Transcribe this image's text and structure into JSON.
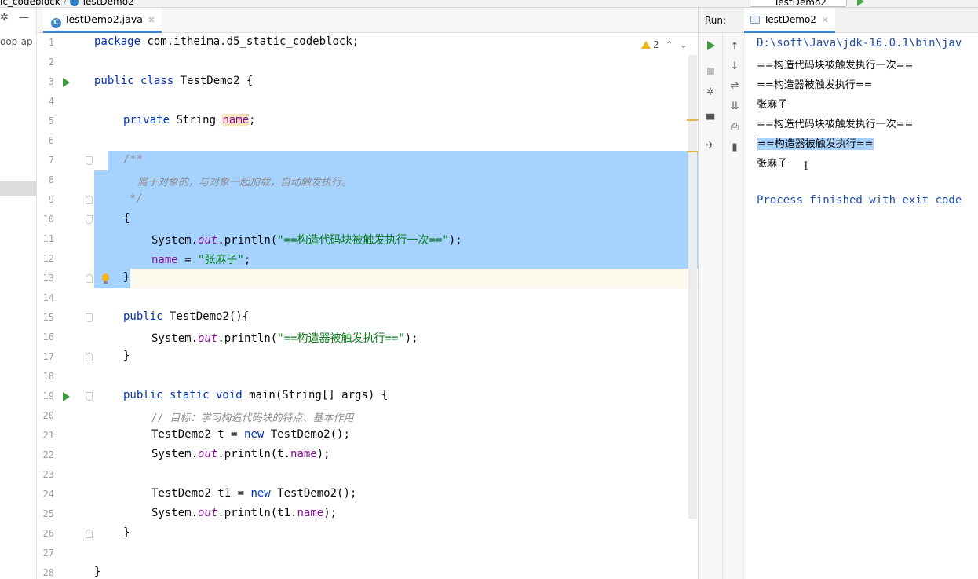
{
  "breadcrumb": {
    "items": [
      "ic_codeblock",
      "TestDemo2"
    ]
  },
  "run_config": {
    "name": "TestDemo2"
  },
  "project": {
    "partial_text": "oop-ap"
  },
  "editor": {
    "tab": {
      "label": "TestDemo2.java",
      "icon": "java-class-icon"
    },
    "warnings": {
      "count": "2"
    },
    "lines": [
      {
        "n": "1"
      },
      {
        "n": "2"
      },
      {
        "n": "3"
      },
      {
        "n": "4"
      },
      {
        "n": "5"
      },
      {
        "n": "6"
      },
      {
        "n": "7"
      },
      {
        "n": "8"
      },
      {
        "n": "9"
      },
      {
        "n": "10"
      },
      {
        "n": "11"
      },
      {
        "n": "12"
      },
      {
        "n": "13"
      },
      {
        "n": "14"
      },
      {
        "n": "15"
      },
      {
        "n": "16"
      },
      {
        "n": "17"
      },
      {
        "n": "18"
      },
      {
        "n": "19"
      },
      {
        "n": "20"
      },
      {
        "n": "21"
      },
      {
        "n": "22"
      },
      {
        "n": "23"
      },
      {
        "n": "24"
      },
      {
        "n": "25"
      },
      {
        "n": "26"
      },
      {
        "n": "27"
      },
      {
        "n": "28"
      }
    ],
    "code": {
      "l1_kw": "package",
      "l1_rest": " com.itheima.d5_static_codeblock;",
      "l3_kw": "public class",
      "l3_rest": " TestDemo2 {",
      "l5_kw": "private",
      "l5_type": " String ",
      "l5_field": "name",
      "l5_end": ";",
      "l7": "/**",
      "l8": "属于对象的，与对象一起加载，自动触发执行。",
      "l9": "*/",
      "l10": "{",
      "l11_a": "System.",
      "l11_out": "out",
      "l11_b": ".println(",
      "l11_str": "\"==构造代码块被触发执行一次==\"",
      "l11_c": ");",
      "l12_field": "name",
      "l12_eq": " = ",
      "l12_str": "\"张麻子\"",
      "l12_end": ";",
      "l13": "}",
      "l15_kw": "public",
      "l15_rest": " TestDemo2(){",
      "l16_a": "System.",
      "l16_out": "out",
      "l16_b": ".println(",
      "l16_str": "\"==构造器被触发执行==\"",
      "l16_c": ");",
      "l17": "}",
      "l19_kw": "public static void",
      "l19_rest": " main(String[] args) {",
      "l20": "// 目标：学习构造代码块的特点、基本作用",
      "l21_a": "TestDemo2 t = ",
      "l21_kw": "new",
      "l21_b": " TestDemo2();",
      "l22_a": "System.",
      "l22_out": "out",
      "l22_b": ".println(t.",
      "l22_field": "name",
      "l22_c": ");",
      "l24_a": "TestDemo2 t1 = ",
      "l24_kw": "new",
      "l24_b": " TestDemo2();",
      "l25_a": "System.",
      "l25_out": "out",
      "l25_b": ".println(t1.",
      "l25_field": "name",
      "l25_c": ");",
      "l26": "}",
      "l28": "}"
    }
  },
  "run": {
    "label": "Run:",
    "tab": "TestDemo2",
    "console": [
      "D:\\soft\\Java\\jdk-16.0.1\\bin\\jav",
      "==构造代码块被触发执行一次==",
      "==构造器被触发执行==",
      "张麻子",
      "==构造代码块被触发执行一次==",
      "==构造器被触发执行==",
      "张麻子",
      "",
      "Process finished with exit code"
    ]
  },
  "colors": {
    "selection": "#a6d2ff",
    "keyword": "#0033b3",
    "string": "#067d17",
    "field": "#871094",
    "comment": "#8c8c8c"
  }
}
